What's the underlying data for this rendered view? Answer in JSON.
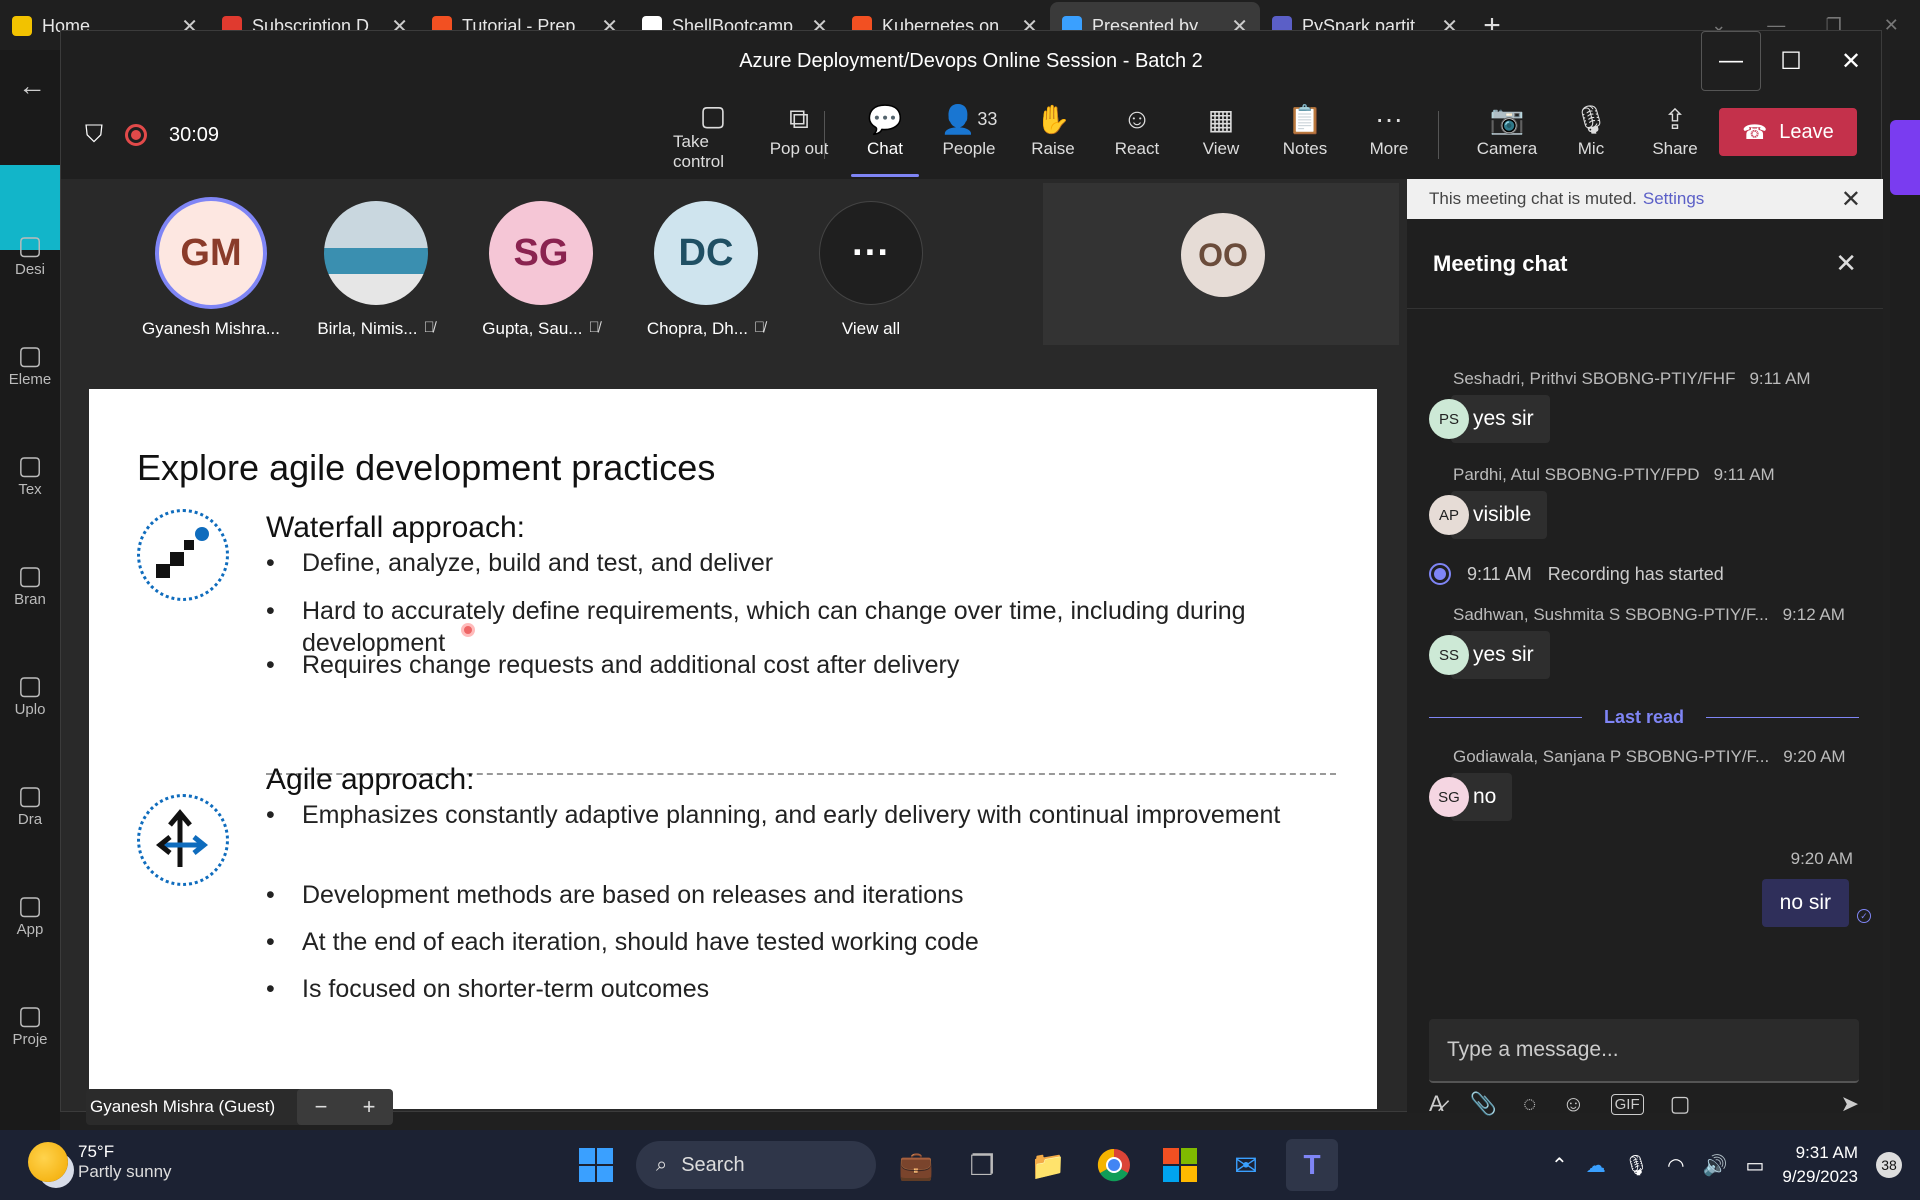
{
  "browser": {
    "tabs": [
      {
        "title": "Home",
        "color": "#f2c200"
      },
      {
        "title": "Subscription D",
        "color": "#e03a2f"
      },
      {
        "title": "Tutorial - Prep",
        "color": "#f25022"
      },
      {
        "title": "ShellBootcamp",
        "color": "#ffffff"
      },
      {
        "title": "Kubernetes on",
        "color": "#f25022"
      },
      {
        "title": "Presented by",
        "color": "#3aa0ff"
      },
      {
        "title": "PySpark partit",
        "color": "#5b5fc7"
      }
    ],
    "new_tab": "+",
    "side_items": [
      "Desi",
      "Eleme",
      "Tex",
      "Bran",
      "Uplo",
      "Dra",
      "App",
      "Proje"
    ]
  },
  "window": {
    "title": "Azure Deployment/Devops Online Session - Batch 2"
  },
  "toolbar": {
    "timer": "30:09",
    "buttons": [
      {
        "label": "Take control",
        "icon": "take-control-icon",
        "glyph": "▢"
      },
      {
        "label": "Pop out",
        "icon": "pop-out-icon",
        "glyph": "⧉"
      },
      {
        "label": "Chat",
        "icon": "chat-icon",
        "glyph": "💬"
      },
      {
        "label": "People",
        "icon": "people-icon",
        "glyph": "👤"
      },
      {
        "label": "Raise",
        "icon": "raise-hand-icon",
        "glyph": "✋"
      },
      {
        "label": "React",
        "icon": "react-icon",
        "glyph": "☺"
      },
      {
        "label": "View",
        "icon": "view-icon",
        "glyph": "▦"
      },
      {
        "label": "Notes",
        "icon": "notes-icon",
        "glyph": "📋"
      },
      {
        "label": "More",
        "icon": "more-icon",
        "glyph": "···"
      },
      {
        "label": "Camera",
        "icon": "camera-off-icon",
        "glyph": "📷"
      },
      {
        "label": "Mic",
        "icon": "mic-off-icon",
        "glyph": "🎙"
      },
      {
        "label": "Share",
        "icon": "share-icon",
        "glyph": "⇪"
      }
    ],
    "people_count": "33",
    "leave_label": "Leave"
  },
  "participants": [
    {
      "initials": "GM",
      "name": "Gyanesh Mishra...",
      "bg": "#fde7e1",
      "fg": "#8a3b2a",
      "muted": false,
      "speaking": true
    },
    {
      "initials": "",
      "name": "Birla, Nimis...",
      "bg": "#5c7a8a",
      "fg": "#fff",
      "muted": true,
      "photo": true
    },
    {
      "initials": "SG",
      "name": "Gupta, Sau...",
      "bg": "#f5c6d6",
      "fg": "#8a2350",
      "muted": true
    },
    {
      "initials": "DC",
      "name": "Chopra, Dh...",
      "bg": "#cfe4ee",
      "fg": "#1f4f63",
      "muted": true
    },
    {
      "initials": "···",
      "name": "View all",
      "bg": "#1f1f1f",
      "fg": "#fff",
      "muted": false
    }
  ],
  "spotlight": {
    "initials": "OO"
  },
  "slide": {
    "title": "Explore agile development practices",
    "waterfall": {
      "heading": "Waterfall approach:",
      "bullets": [
        "Define, analyze, build and test, and deliver",
        "Hard to accurately define requirements, which can change over time, including during development",
        "Requires change requests and additional cost after delivery"
      ]
    },
    "agile": {
      "heading": "Agile approach:",
      "bullets": [
        "Emphasizes constantly adaptive planning, and early delivery with continual improvement",
        "Development methods are based on releases and iterations",
        "At the end of each iteration, should have tested working code",
        "Is focused on shorter-term outcomes"
      ]
    },
    "presenter_chip": "Gyanesh Mishra (Guest)"
  },
  "chat": {
    "muted_notice": "This meeting chat is muted.",
    "settings_link": "Settings",
    "title": "Meeting chat",
    "messages": [
      {
        "sender": "Seshadri, Prithvi SBOBNG-PTIY/FHF",
        "time": "9:11 AM",
        "initials": "PS",
        "avatar_bg": "#cde9d6",
        "text": "yes sir"
      },
      {
        "sender": "Pardhi, Atul SBOBNG-PTIY/FPD",
        "time": "9:11 AM",
        "initials": "AP",
        "avatar_bg": "#e6dcd6",
        "text": "visible"
      },
      {
        "sender": "Sadhwan, Sushmita S SBOBNG-PTIY/F...",
        "time": "9:12 AM",
        "initials": "SS",
        "avatar_bg": "#cde9d6",
        "text": "yes sir"
      },
      {
        "sender": "Godiawala, Sanjana P SBOBNG-PTIY/F...",
        "time": "9:20 AM",
        "initials": "SG",
        "avatar_bg": "#f5d6e2",
        "text": "no"
      }
    ],
    "system_event": {
      "time": "9:11 AM",
      "text": "Recording has started"
    },
    "last_read": "Last read",
    "my_message": {
      "time": "9:20 AM",
      "text": "no sir"
    },
    "compose_placeholder": "Type a message..."
  },
  "taskbar": {
    "temperature": "75°F",
    "condition": "Partly sunny",
    "search_label": "Search",
    "time": "9:31 AM",
    "date": "9/29/2023",
    "notification_count": "38"
  }
}
